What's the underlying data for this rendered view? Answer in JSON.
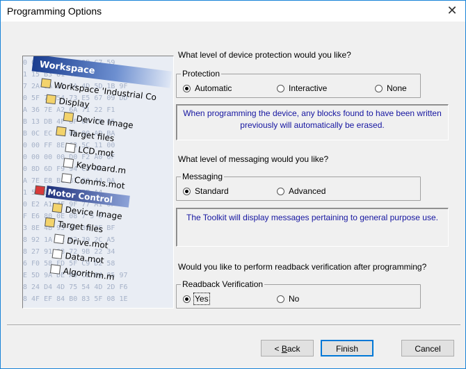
{
  "window": {
    "title": "Programming Options",
    "close_glyph": "✕"
  },
  "picture": {
    "workspace_label": "Workspace",
    "tree": {
      "root": "Workspace 'Industrial Co",
      "display": "Display",
      "device_image_1": "Device Image",
      "target_files_1": "Target files",
      "lcd": "LCD.mot",
      "keyboard": "Keyboard.m",
      "comms": "Comms.mot",
      "motor_control": "Motor Control",
      "device_image_2": "Device Image",
      "target_files_2": "Target files",
      "drive": "Drive.mot",
      "data": "Data.mot",
      "algorithm": "Algorithm.m"
    },
    "hex_rows": [
      "0 C0 4B B3 8D 9B C7 59",
      "1 15 B3 81 48 DA FF 5B",
      "7 2A 9A 21 2A 4D 5D 1B 9F",
      "0 5F 7D 54 73 E5 67 09 DD",
      "A 36 7E A2 6A 71 22 F1",
      "B 13 DB 4F 6F 0F 70 05",
      "B 0C EC 8B 00 00 AD BA",
      "0 00 FF 8E 63 5C 11 00",
      "0 00 00 00 D0 F2 A0 0F",
      "0 8D 6D F9 94 C4 AC",
      "A 7E E8 B1 81 80 44 0A",
      "1 5E 8A 33 A4 7B A4",
      "0 E2 A1 4F 9F 77 A1 0F",
      "F E6 80 0E 08 7 5 0",
      "3 8E 4B 95 81 39 3F BF",
      "8 92 1A 2C 62 39 2C A5",
      "8 27 91 08 72 9B 22 34",
      "6 F0 58 FD 5F C9 D2 58",
      "E 5D 9A DE A9 C5 64 85 97",
      "8 24 D4 4D 75 54 4D 2D F6",
      "8 4F EF 84 B0 83 5F 08 1E"
    ]
  },
  "protection": {
    "question": "What level of device protection would you like?",
    "legend": "Protection",
    "options": [
      "Automatic",
      "Interactive",
      "None"
    ],
    "selected": "Automatic",
    "info": "When programming the device, any blocks found to have been written previously will automatically be erased."
  },
  "messaging": {
    "question": "What level of messaging would you like?",
    "legend": "Messaging",
    "options": [
      "Standard",
      "Advanced"
    ],
    "selected": "Standard",
    "info": "The Toolkit will display messages pertaining to general purpose use."
  },
  "readback": {
    "question": "Would you like to perform readback verification after programming?",
    "legend": "Readback Verification",
    "options": [
      "Yes",
      "No"
    ],
    "selected": "Yes"
  },
  "buttons": {
    "back": "< Back",
    "back_mnemonic": "B",
    "finish": "Finish",
    "cancel": "Cancel"
  },
  "colors": {
    "info_text": "#1515a0",
    "window_border": "#1883d7",
    "default_button_border": "#0078d7"
  }
}
